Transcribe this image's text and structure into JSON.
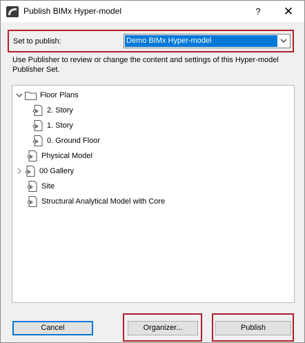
{
  "window": {
    "title": "Publish BIMx Hyper-model",
    "help_label": "?",
    "close_label": "✕"
  },
  "publish": {
    "label": "Set to publish:",
    "selected": "Demo BIMx Hyper-model"
  },
  "description": "Use Publisher to review or change the content and settings of this Hyper-model Publisher Set.",
  "tree": {
    "floor_plans": "Floor Plans",
    "story2": "2. Story",
    "story1": "1. Story",
    "ground": "0. Ground Floor",
    "physical": "Physical Model",
    "gallery": "00 Gallery",
    "site": "Site",
    "structural": "Structural Analytical Model with Core"
  },
  "buttons": {
    "cancel": "Cancel",
    "organizer": "Organizer...",
    "publish": "Publish"
  },
  "colors": {
    "highlight": "#b0202a",
    "selection": "#0078d7"
  }
}
